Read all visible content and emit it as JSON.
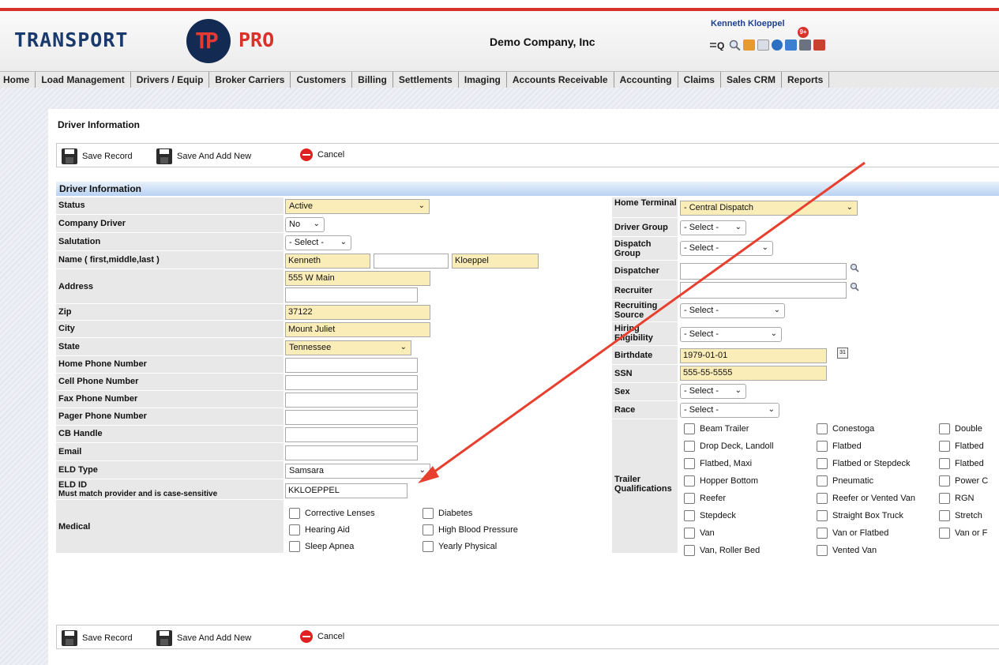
{
  "header": {
    "logo_left": "TRANSPORT",
    "logo_mark": "TP",
    "logo_right": "PRO",
    "company": "Demo Company, Inc",
    "user": "Kenneth Kloeppel",
    "notification_badge": "9+"
  },
  "nav": [
    "Home",
    "Load Management",
    "Drivers / Equip",
    "Broker Carriers",
    "Customers",
    "Billing",
    "Settlements",
    "Imaging",
    "Accounts Receivable",
    "Accounting",
    "Claims",
    "Sales CRM",
    "Reports"
  ],
  "page_title": "Driver Information",
  "toolbar": {
    "save": "Save Record",
    "save_add": "Save And Add New",
    "cancel": "Cancel"
  },
  "section_title": "Driver Information",
  "left": {
    "status": {
      "label": "Status",
      "value": "Active"
    },
    "company_driver": {
      "label": "Company Driver",
      "value": "No"
    },
    "salutation": {
      "label": "Salutation",
      "value": "- Select -"
    },
    "name": {
      "label": "Name ( first,middle,last )",
      "first": "Kenneth",
      "middle": "",
      "last": "Kloeppel"
    },
    "address": {
      "label": "Address",
      "line1": "555 W Main",
      "line2": ""
    },
    "zip": {
      "label": "Zip",
      "value": "37122"
    },
    "city": {
      "label": "City",
      "value": "Mount Juliet"
    },
    "state": {
      "label": "State",
      "value": "Tennessee"
    },
    "home_phone": {
      "label": "Home Phone Number",
      "value": ""
    },
    "cell_phone": {
      "label": "Cell Phone Number",
      "value": ""
    },
    "fax_phone": {
      "label": "Fax Phone Number",
      "value": ""
    },
    "pager_phone": {
      "label": "Pager Phone Number",
      "value": ""
    },
    "cb_handle": {
      "label": "CB Handle",
      "value": ""
    },
    "email": {
      "label": "Email",
      "value": ""
    },
    "eld_type": {
      "label": "ELD Type",
      "value": "Samsara"
    },
    "eld_id": {
      "label": "ELD ID",
      "note": "Must match provider and is case-sensitive",
      "value": "KKLOEPPEL"
    },
    "medical": {
      "label": "Medical",
      "options": [
        "Corrective Lenses",
        "Diabetes",
        "Hearing Aid",
        "High Blood Pressure",
        "Sleep Apnea",
        "Yearly Physical"
      ]
    }
  },
  "right": {
    "home_terminal": {
      "label": "Home Terminal",
      "value": "- Central Dispatch"
    },
    "driver_group": {
      "label": "Driver Group",
      "value": "- Select -"
    },
    "dispatch_group": {
      "label": "Dispatch Group",
      "value": "- Select -"
    },
    "dispatcher": {
      "label": "Dispatcher",
      "value": ""
    },
    "recruiter": {
      "label": "Recruiter",
      "value": ""
    },
    "recruiting_source": {
      "label": "Recruiting Source",
      "value": "- Select -"
    },
    "hiring_eligibility": {
      "label": "Hiring Eligibility",
      "value": "- Select -"
    },
    "birthdate": {
      "label": "Birthdate",
      "value": "1979-01-01",
      "cal": "31"
    },
    "ssn": {
      "label": "SSN",
      "value": "555-55-5555"
    },
    "sex": {
      "label": "Sex",
      "value": "- Select -"
    },
    "race": {
      "label": "Race",
      "value": "- Select -"
    },
    "trailer": {
      "label": "Trailer Qualifications",
      "col1": [
        "Beam Trailer",
        "Drop Deck, Landoll",
        "Flatbed, Maxi",
        "Hopper Bottom",
        "Reefer",
        "Stepdeck",
        "Van",
        "Van, Roller Bed"
      ],
      "col2": [
        "Conestoga",
        "Flatbed",
        "Flatbed or Stepdeck",
        "Pneumatic",
        "Reefer or Vented Van",
        "Straight Box Truck",
        "Van or Flatbed",
        "Vented Van"
      ],
      "col3": [
        "Double",
        "Flatbed",
        "Flatbed",
        "Power C",
        "RGN",
        "Stretch",
        "Van or F"
      ]
    }
  },
  "colors": {
    "accent_red": "#d9322b",
    "highlight_field": "#fbedb7",
    "navy": "#1a3a6e",
    "section_blue": "#b8d2f3"
  }
}
